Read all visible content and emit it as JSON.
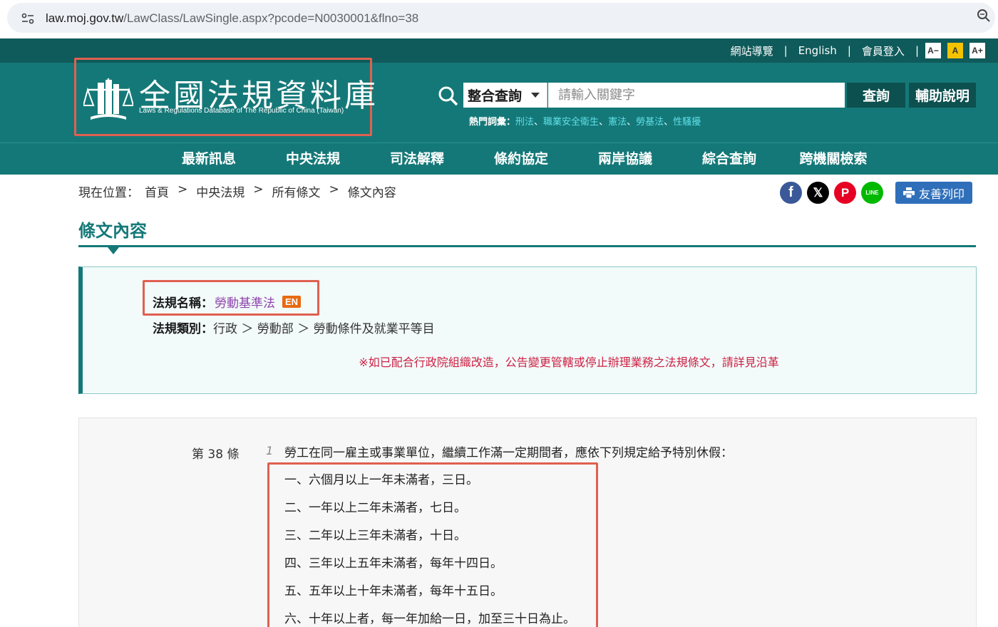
{
  "browser": {
    "url_host": "law.moj.gov.tw",
    "url_path": "/LawClass/LawSingle.aspx?pcode=N0030001&flno=38"
  },
  "top_links": {
    "sitemap": "網站導覽",
    "english": "English",
    "login": "會員登入",
    "font_small": "A−",
    "font_mid": "A",
    "font_large": "A+"
  },
  "logo": {
    "title": "全國法規資料庫",
    "subtitle": "Laws & Regulations Database of The Republic of China (Taiwan)"
  },
  "search": {
    "select_label": "整合查詢",
    "placeholder": "請輸入關鍵字",
    "button": "查詢",
    "help": "輔助說明",
    "hot_label": "熱門詞彙：",
    "hot_words": [
      "刑法",
      "職業安全衛生",
      "憲法",
      "勞基法",
      "性騷擾"
    ]
  },
  "nav": [
    "最新訊息",
    "中央法規",
    "司法解釋",
    "條約協定",
    "兩岸協議",
    "綜合查詢",
    "跨機關檢索"
  ],
  "breadcrumb": {
    "label": "現在位置：",
    "items": [
      "首頁",
      "中央法規",
      "所有條文",
      "條文內容"
    ],
    "sep": ">"
  },
  "share": {
    "print": "友善列印"
  },
  "page_title": "條文內容",
  "law_info": {
    "name_label": "法規名稱：",
    "name_value": "勞動基準法",
    "en_badge": "EN",
    "category_label": "法規類別：",
    "category_value": "行政 ＞ 勞動部 ＞ 勞動條件及就業平等目",
    "notice": "※如已配合行政院組織改造，公告變更管轄或停止辦理業務之法規條文，請詳見沿革"
  },
  "article": {
    "number": "第 38 條",
    "paragraph_no": "1",
    "main_text": "勞工在同一雇主或事業單位，繼續工作滿一定期間者，應依下列規定給予特別休假：",
    "items": [
      "一、六個月以上一年未滿者，三日。",
      "二、一年以上二年未滿者，七日。",
      "三、二年以上三年未滿者，十日。",
      "四、三年以上五年未滿者，每年十四日。",
      "五、五年以上十年未滿者，每年十五日。",
      "六、十年以上者，每一年加給一日，加至三十日為止。"
    ]
  }
}
